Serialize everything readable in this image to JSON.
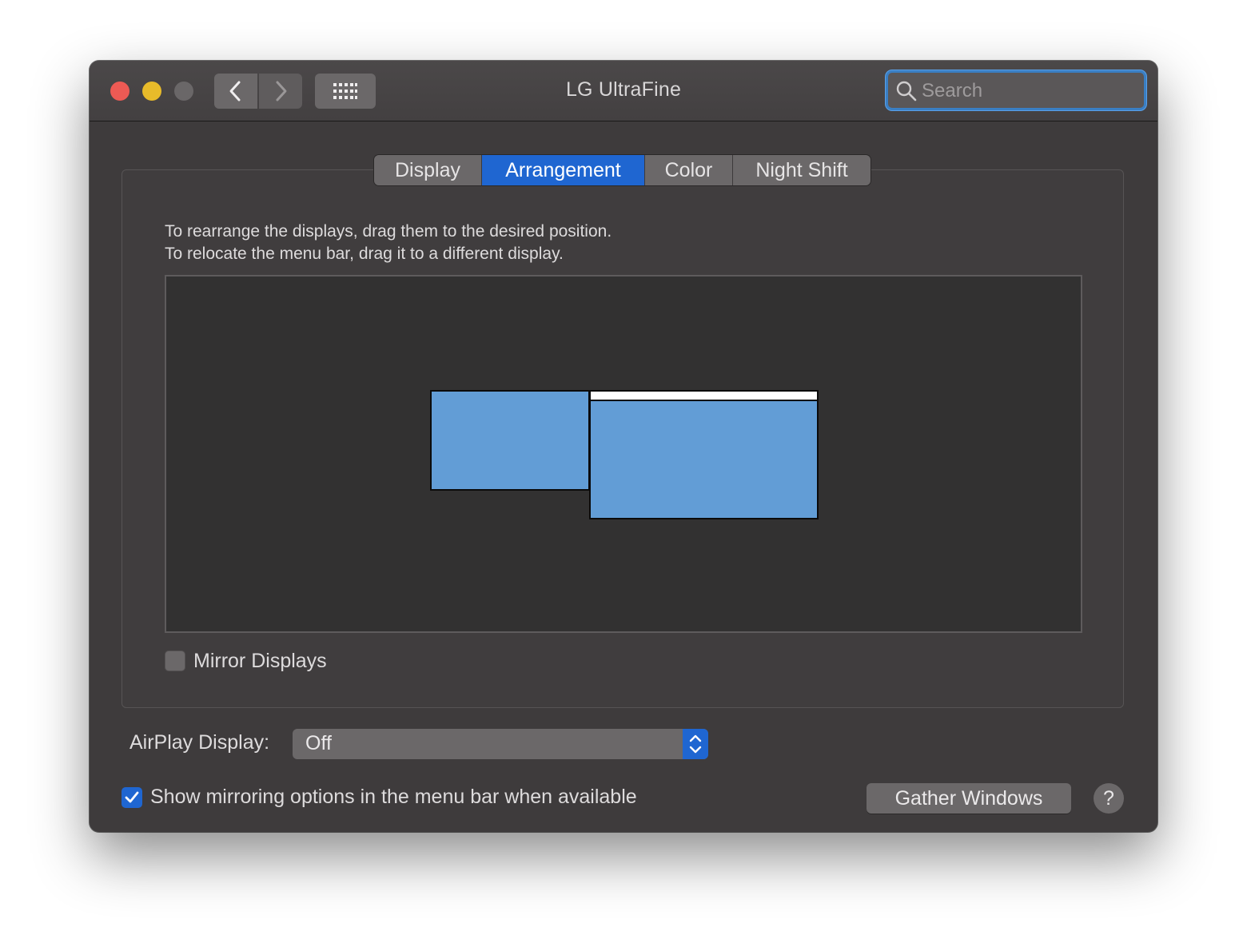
{
  "window": {
    "title": "LG UltraFine"
  },
  "toolbar": {
    "back_icon": "chevron-left-icon",
    "forward_icon": "chevron-right-icon",
    "grid_icon": "show-all-grid-icon"
  },
  "search": {
    "placeholder": "Search",
    "value": ""
  },
  "tabs": [
    {
      "label": "Display",
      "active": false
    },
    {
      "label": "Arrangement",
      "active": true
    },
    {
      "label": "Color",
      "active": false
    },
    {
      "label": "Night Shift",
      "active": false
    }
  ],
  "arrangement": {
    "instruction_line1": "To rearrange the displays, drag them to the desired position.",
    "instruction_line2": "To relocate the menu bar, drag it to a different display.",
    "mirror_label": "Mirror Displays",
    "mirror_checked": false
  },
  "airplay": {
    "label": "AirPlay Display:",
    "value": "Off"
  },
  "footer": {
    "show_mirroring_label": "Show mirroring options in the menu bar when available",
    "show_mirroring_checked": true,
    "gather_label": "Gather Windows",
    "help_label": "?"
  },
  "colors": {
    "accent": "#1f66d1",
    "display_fill": "#629dd6",
    "close": "#ed5a54",
    "minimize": "#e8bb2a"
  }
}
